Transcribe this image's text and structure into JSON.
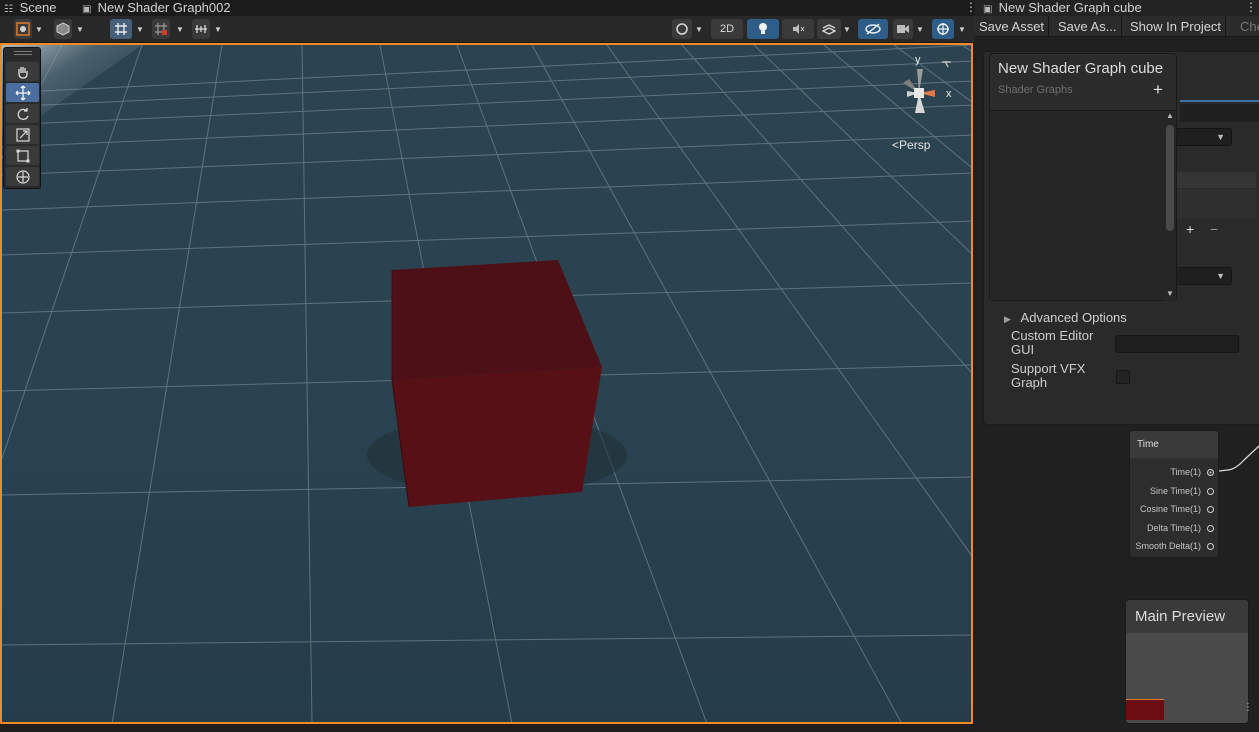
{
  "scene_window": {
    "tabs": [
      {
        "label": "Scene",
        "icon": "grid-icon"
      },
      {
        "label": "New Shader Graph002",
        "icon": "shader-file-icon"
      }
    ],
    "toolbar": {
      "two_d_label": "2D",
      "accent_color": "#f08a24"
    },
    "camera_label": "Persp",
    "gizmo_axes": {
      "y": "y",
      "x": "x"
    },
    "scene_object": "red cube",
    "cube_color": "#6b0e14"
  },
  "shader_graph_window": {
    "tab_label": "New Shader Graph cube",
    "toolbar": {
      "save_asset": "Save Asset",
      "save_as": "Save As...",
      "show_in_project": "Show In Project",
      "check_out": "Chec"
    },
    "blackboard": {
      "title": "New Shader Graph cube",
      "subtitle": "Shader Graphs",
      "add_symbol": "+"
    },
    "inspector": {
      "list_add": "+",
      "list_remove": "−",
      "advanced_options": "Advanced Options",
      "custom_editor_gui": "Custom Editor GUI",
      "support_vfx_graph": "Support VFX Graph"
    },
    "time_node": {
      "title": "Time",
      "ports": [
        "Time(1)",
        "Sine Time(1)",
        "Cosine Time(1)",
        "Delta Time(1)",
        "Smooth Delta(1)"
      ]
    },
    "main_preview": {
      "title": "Main Preview"
    }
  }
}
